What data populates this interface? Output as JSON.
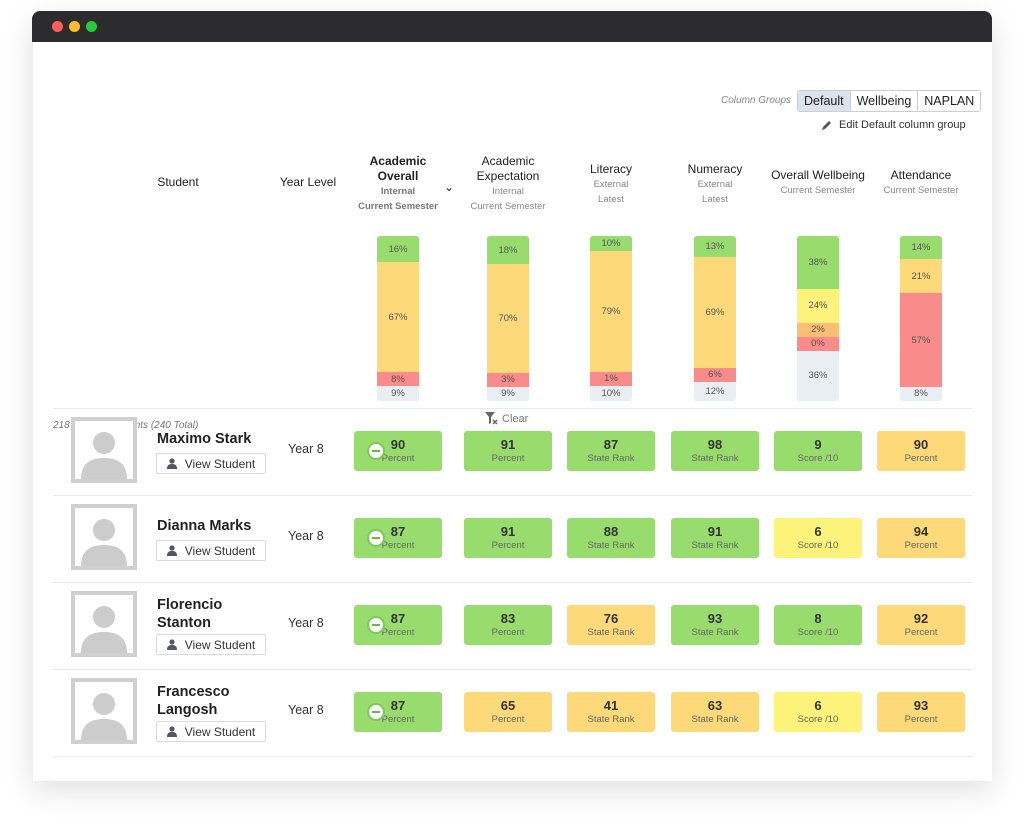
{
  "colors": {
    "green": "#98dc6e",
    "amber": "#fdd97a",
    "red": "#f98b8b",
    "grey": "#e9eef3",
    "yellow": "#fdf27a",
    "orange": "#fbbe72"
  },
  "column_groups": {
    "label": "Column Groups",
    "options": [
      "Default",
      "Wellbeing",
      "NAPLAN"
    ],
    "selected": "Default",
    "edit_label": "Edit Default column group"
  },
  "headers": {
    "student": "Student",
    "year_level": "Year Level"
  },
  "columns": [
    {
      "title": "Academic Overall",
      "sub1": "Internal",
      "sub2": "Current Semester",
      "sorted": true,
      "dist": [
        {
          "v": 16,
          "c": "green"
        },
        {
          "v": 67,
          "c": "amber"
        },
        {
          "v": 8,
          "c": "red"
        },
        {
          "v": 9,
          "c": "grey"
        }
      ]
    },
    {
      "title": "Academic Expectation",
      "sub1": "Internal",
      "sub2": "Current Semester",
      "dist": [
        {
          "v": 18,
          "c": "green"
        },
        {
          "v": 70,
          "c": "amber"
        },
        {
          "v": 3,
          "c": "red"
        },
        {
          "v": 9,
          "c": "grey"
        }
      ]
    },
    {
      "title": "Literacy",
      "sub1": "External",
      "sub2": "Latest",
      "dist": [
        {
          "v": 10,
          "c": "green"
        },
        {
          "v": 79,
          "c": "amber"
        },
        {
          "v": 1,
          "c": "red"
        },
        {
          "v": 10,
          "c": "grey"
        }
      ]
    },
    {
      "title": "Numeracy",
      "sub1": "External",
      "sub2": "Latest",
      "dist": [
        {
          "v": 13,
          "c": "green"
        },
        {
          "v": 69,
          "c": "amber"
        },
        {
          "v": 6,
          "c": "red"
        },
        {
          "v": 12,
          "c": "grey"
        }
      ]
    },
    {
      "title": "Overall Wellbeing",
      "sub1": "Current Semester",
      "sub2": "",
      "dist": [
        {
          "v": 38,
          "c": "green"
        },
        {
          "v": 24,
          "c": "yellow"
        },
        {
          "v": 2,
          "c": "orange"
        },
        {
          "v": 0,
          "c": "red"
        },
        {
          "v": 36,
          "c": "grey"
        }
      ]
    },
    {
      "title": "Attendance",
      "sub1": "Current Semester",
      "sub2": "",
      "dist": [
        {
          "v": 14,
          "c": "green"
        },
        {
          "v": 21,
          "c": "amber"
        },
        {
          "v": 57,
          "c": "red"
        },
        {
          "v": 8,
          "c": "grey"
        }
      ]
    }
  ],
  "filtered_text": "218 Filtered Students (240 Total)",
  "clear_label": "Clear",
  "view_label": "View Student",
  "students": [
    {
      "name": "Maximo Stark",
      "year": "Year 8",
      "cells": [
        {
          "v": "90",
          "l": "Percent",
          "c": "green"
        },
        {
          "v": "91",
          "l": "Percent",
          "c": "green"
        },
        {
          "v": "87",
          "l": "State Rank",
          "c": "green"
        },
        {
          "v": "98",
          "l": "State Rank",
          "c": "green"
        },
        {
          "v": "9",
          "l": "Score /10",
          "c": "green"
        },
        {
          "v": "90",
          "l": "Percent",
          "c": "amber"
        }
      ]
    },
    {
      "name": "Dianna Marks",
      "year": "Year 8",
      "cells": [
        {
          "v": "87",
          "l": "Percent",
          "c": "green"
        },
        {
          "v": "91",
          "l": "Percent",
          "c": "green"
        },
        {
          "v": "88",
          "l": "State Rank",
          "c": "green"
        },
        {
          "v": "91",
          "l": "State Rank",
          "c": "green"
        },
        {
          "v": "6",
          "l": "Score /10",
          "c": "yellow"
        },
        {
          "v": "94",
          "l": "Percent",
          "c": "amber"
        }
      ]
    },
    {
      "name": "Florencio Stanton",
      "year": "Year 8",
      "cells": [
        {
          "v": "87",
          "l": "Percent",
          "c": "green"
        },
        {
          "v": "83",
          "l": "Percent",
          "c": "green"
        },
        {
          "v": "76",
          "l": "State Rank",
          "c": "amber"
        },
        {
          "v": "93",
          "l": "State Rank",
          "c": "green"
        },
        {
          "v": "8",
          "l": "Score /10",
          "c": "green"
        },
        {
          "v": "92",
          "l": "Percent",
          "c": "amber"
        }
      ]
    },
    {
      "name": "Francesco Langosh",
      "year": "Year 8",
      "cells": [
        {
          "v": "87",
          "l": "Percent",
          "c": "green"
        },
        {
          "v": "65",
          "l": "Percent",
          "c": "amber"
        },
        {
          "v": "41",
          "l": "State Rank",
          "c": "amber"
        },
        {
          "v": "63",
          "l": "State Rank",
          "c": "amber"
        },
        {
          "v": "6",
          "l": "Score /10",
          "c": "yellow"
        },
        {
          "v": "93",
          "l": "Percent",
          "c": "amber"
        }
      ]
    }
  ]
}
